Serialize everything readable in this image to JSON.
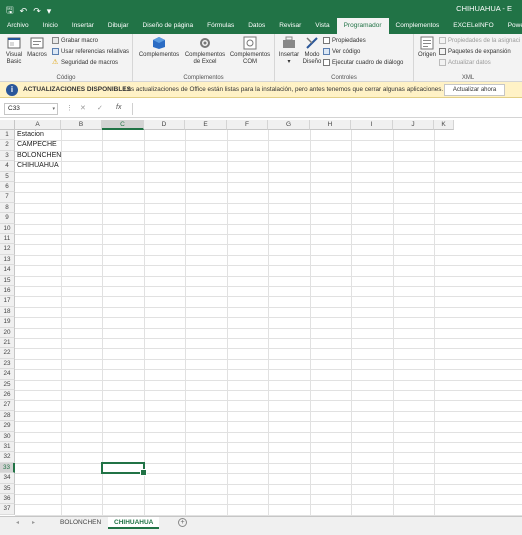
{
  "window": {
    "title": "CHIHUAHUA - E"
  },
  "ribbon": {
    "tabs": [
      "Archivo",
      "Inicio",
      "Insertar",
      "Dibujar",
      "Diseño de página",
      "Fórmulas",
      "Datos",
      "Revisar",
      "Vista",
      "Programador",
      "Complementos",
      "EXCELeINFO",
      "Power P"
    ],
    "active_tab": "Programador",
    "groups": {
      "codigo": {
        "label": "Código",
        "visual_basic": "Visual Basic",
        "macros": "Macros",
        "grabar_macro": "Grabar macro",
        "usar_referencias": "Usar referencias relativas",
        "seguridad": "Seguridad de macros"
      },
      "complementos": {
        "label": "Complementos",
        "complementos": "Complementos",
        "complementos_excel": "Complementos de Excel",
        "complementos_com": "Complementos COM"
      },
      "controles": {
        "label": "Controles",
        "insertar": "Insertar",
        "modo_diseno": "Modo Diseño",
        "propiedades": "Propiedades",
        "ver_codigo": "Ver código",
        "ejecutar_cuadro": "Ejecutar cuadro de diálogo"
      },
      "xml": {
        "label": "XML",
        "origen": "Origen",
        "propiedades_asignacion": "Propiedades de la asignaci",
        "paquetes_expansion": "Paquetes de expansión",
        "actualizar_datos": "Actualizar datos"
      }
    }
  },
  "notification": {
    "title": "ACTUALIZACIONES DISPONIBLES",
    "message": "Las actualizaciones de Office están listas para la instalación, pero antes tenemos que cerrar algunas aplicaciones.",
    "button": "Actualizar ahora"
  },
  "formula_bar": {
    "name_box": "C33",
    "value": ""
  },
  "sheet": {
    "columns": [
      "A",
      "B",
      "C",
      "D",
      "E",
      "F",
      "G",
      "H",
      "I",
      "J",
      "K"
    ],
    "selected_column": "C",
    "selected_row": 33,
    "row_count": 37,
    "cells_col_a": [
      "Estacion",
      "CAMPECHE",
      "BOLONCHEN",
      "CHIHUAHUA"
    ]
  },
  "sheet_tabs": {
    "tabs": [
      "BOLONCHEN",
      "CHIHUAHUA"
    ],
    "active": "CHIHUAHUA"
  }
}
